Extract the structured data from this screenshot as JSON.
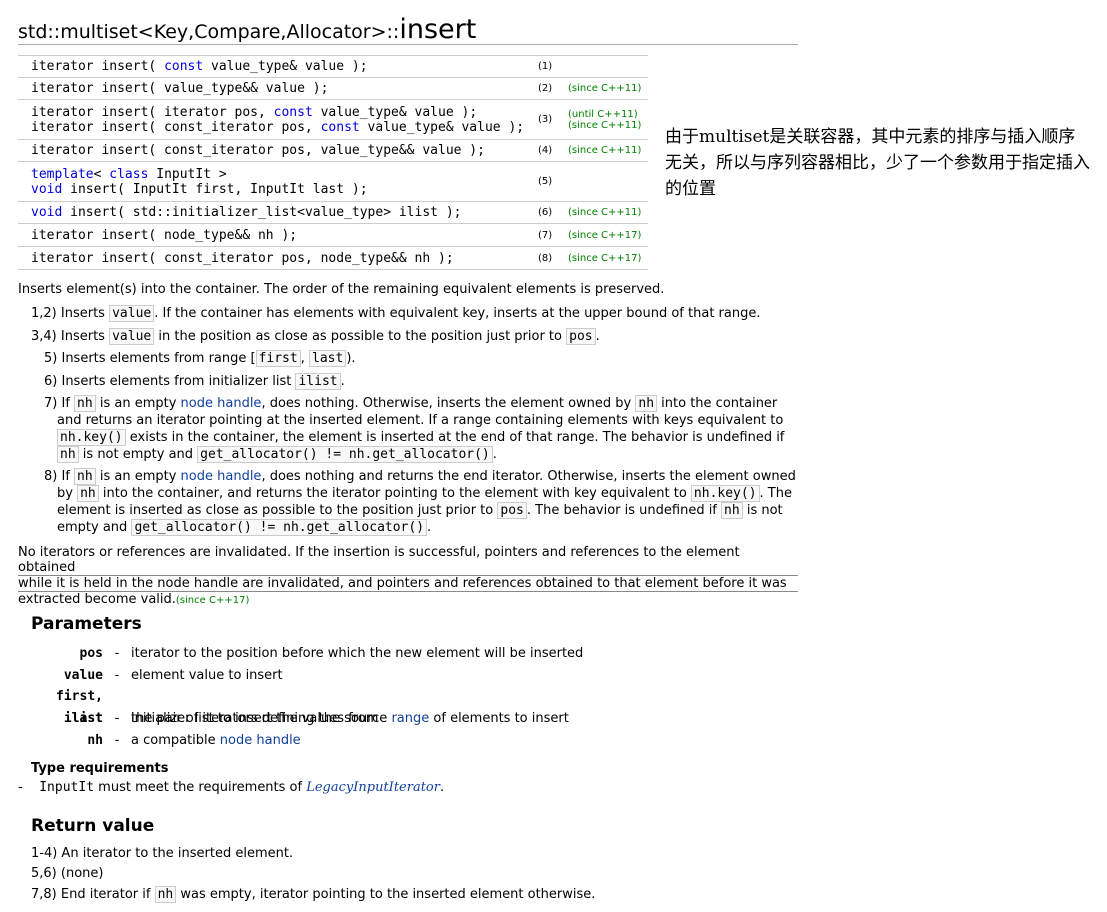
{
  "title": {
    "prefix": "std::multiset<Key,Compare,Allocator>::",
    "name": "insert"
  },
  "declarations": [
    {
      "num": "(1)",
      "since": "",
      "lines": [
        [
          {
            "t": "iterator insert( ",
            "k": false
          },
          {
            "t": "const",
            "k": true
          },
          {
            "t": " value_type& value );",
            "k": false
          }
        ]
      ]
    },
    {
      "num": "(2)",
      "since": "(since C++11)",
      "lines": [
        [
          {
            "t": "iterator insert( value_type&& value );",
            "k": false
          }
        ]
      ]
    },
    {
      "num": "(3)",
      "since": "",
      "since_top": "(until C++11)",
      "since_bottom": "(since C++11)",
      "lines": [
        [
          {
            "t": "iterator insert( iterator pos, ",
            "k": false
          },
          {
            "t": "const",
            "k": true
          },
          {
            "t": " value_type& value );",
            "k": false
          }
        ],
        [
          {
            "t": "iterator insert( const_iterator pos, ",
            "k": false
          },
          {
            "t": "const",
            "k": true
          },
          {
            "t": " value_type& value );",
            "k": false
          }
        ]
      ]
    },
    {
      "num": "(4)",
      "since": "(since C++11)",
      "lines": [
        [
          {
            "t": "iterator insert( const_iterator pos, value_type&& value );",
            "k": false
          }
        ]
      ]
    },
    {
      "num": "(5)",
      "since": "",
      "lines": [
        [
          {
            "t": "template",
            "k": true
          },
          {
            "t": "< ",
            "k": false
          },
          {
            "t": "class",
            "k": true
          },
          {
            "t": " InputIt >",
            "k": false
          }
        ],
        [
          {
            "t": "void",
            "k": true
          },
          {
            "t": " insert( InputIt first, InputIt last );",
            "k": false
          }
        ]
      ]
    },
    {
      "num": "(6)",
      "since": "(since C++11)",
      "lines": [
        [
          {
            "t": "void",
            "k": true
          },
          {
            "t": " insert( std::initializer_list<value_type> ilist );",
            "k": false
          }
        ]
      ]
    },
    {
      "num": "(7)",
      "since": "(since C++17)",
      "lines": [
        [
          {
            "t": "iterator insert( node_type&& nh );",
            "k": false
          }
        ]
      ]
    },
    {
      "num": "(8)",
      "since": "(since C++17)",
      "lines": [
        [
          {
            "t": "iterator insert( const_iterator pos, node_type&& nh );",
            "k": false
          }
        ]
      ]
    }
  ],
  "note": "由于multiset是关联容器，其中元素的排序与插入顺序无关，所以与序列容器相比，少了一个参数用于指定插入的位置",
  "intro": "Inserts element(s) into the container. The order of the remaining equivalent elements is preserved.",
  "items": {
    "i12": {
      "lbl": "1,2)",
      "a": "Inserts",
      "c1": "value",
      "b": ". If the container has elements with equivalent key, inserts at the upper bound of that range."
    },
    "i34": {
      "lbl": "3,4)",
      "a": "Inserts",
      "c1": "value",
      "b": "in the position as close as possible to the position just prior to",
      "c2": "pos",
      "d": "."
    },
    "i5": {
      "lbl": "5)",
      "a": "Inserts elements from range [",
      "c1": "first",
      "m": ",",
      "c2": "last",
      "d": ")."
    },
    "i6": {
      "lbl": "6)",
      "a": "Inserts elements from initializer list",
      "c1": "ilist",
      "d": "."
    },
    "i7": {
      "lbl": "7)",
      "if": "If",
      "nh": "nh",
      "empty": "is an empty",
      "node_handle": "node handle",
      "l1b": ", does nothing. Otherwise, inserts the element owned by",
      "l1c": "into the container",
      "l2": "and returns an iterator pointing at the inserted element. If a range containing elements with keys equivalent to",
      "nhkey": "nh.key()",
      "l3": "exists in the container, the element is inserted at the end of that range. The behavior is undefined if",
      "l4a": "is not empty and",
      "getalloc": "get_allocator() != nh.get_allocator()",
      "dot": "."
    },
    "i8": {
      "lbl": "8)",
      "if": "If",
      "nh": "nh",
      "empty": "is an empty",
      "node_handle": "node handle",
      "l1b": ", does nothing and returns the end iterator. Otherwise, inserts the element owned",
      "l2a": "by",
      "l2b": "into the container, and returns the iterator pointing to the element with key equivalent to",
      "nhkey": "nh.key()",
      "l2c": ". The",
      "l3a": "element is inserted as close as possible to the position just prior to",
      "pos": "pos",
      "l3b": ". The behavior is undefined if",
      "l3c": "is not",
      "l4a": "empty and",
      "getalloc": "get_allocator() != nh.get_allocator()",
      "dot": "."
    }
  },
  "invalid": {
    "a": "No iterators or references are invalidated.",
    "b": "If the insertion is successful, pointers and references to the element obtained",
    "c": "while it is held in the node handle are invalidated, and pointers and references obtained to that element before it was",
    "d": "extracted become valid.",
    "since": "(since C++17)"
  },
  "parameters": {
    "heading": "Parameters",
    "rows": [
      {
        "name": "pos",
        "dash": "-",
        "desc": "iterator to the position before which the new element will be inserted"
      },
      {
        "name": "value",
        "dash": "-",
        "desc": "element value to insert"
      },
      {
        "name": "first, last",
        "dash": "-",
        "desc_a": "the pair of iterators defining the source",
        "desc_link": "range",
        "desc_b": "of elements to insert"
      },
      {
        "name": "ilist",
        "dash": "-",
        "desc": "initializer list to insert the values from"
      },
      {
        "name": "nh",
        "dash": "-",
        "desc_a": "a compatible",
        "desc_link": "node handle"
      }
    ],
    "type_req": "Type requirements",
    "req_dash": "-",
    "req_code": "InputIt",
    "req_text": "must meet the requirements of",
    "req_link": "LegacyInputIterator",
    "req_end": "."
  },
  "return_value": {
    "heading": "Return value",
    "r1": "1-4) An iterator to the inserted element.",
    "r2": "5,6) (none)",
    "r3a": "7,8) End iterator if",
    "r3c": "nh",
    "r3b": "was empty, iterator pointing to the inserted element otherwise."
  }
}
